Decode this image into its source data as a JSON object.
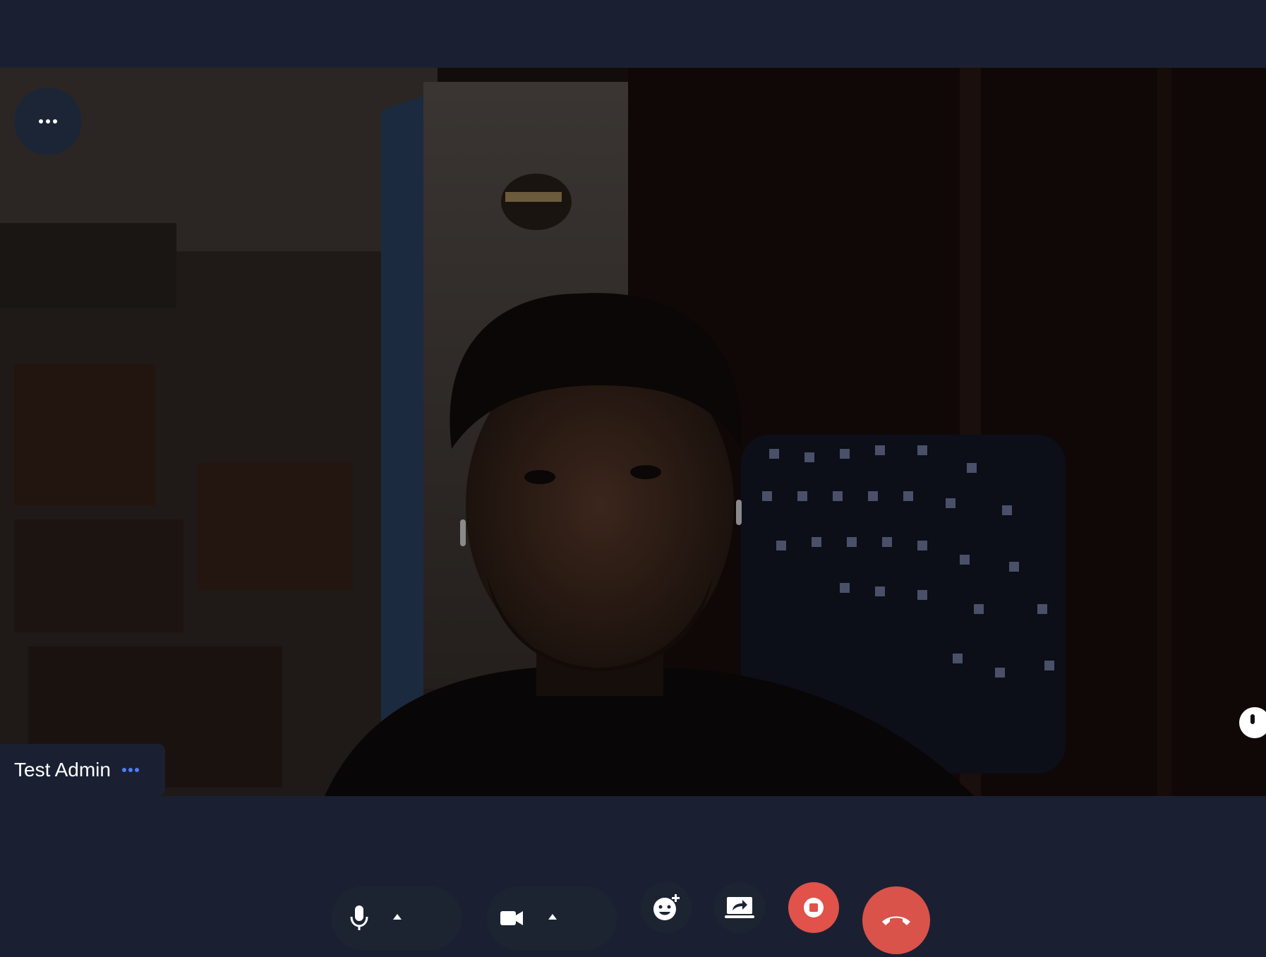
{
  "participant": {
    "name": "Test Admin"
  },
  "icons": {
    "more_options": "more-horizontal-icon",
    "participant_more": "more-horizontal-icon",
    "microphone": "microphone-icon",
    "camera": "video-camera-icon",
    "caret": "caret-up-icon",
    "reactions": "emoji-add-icon",
    "share_screen": "share-screen-icon",
    "stop_recording": "stop-icon",
    "leave_call": "phone-hangup-icon"
  },
  "colors": {
    "background": "#1a2031",
    "control_pill": "#1c2432",
    "record_button": "#e0524a",
    "hangup_button": "#d9534a",
    "name_dots": "#4f7cff"
  }
}
